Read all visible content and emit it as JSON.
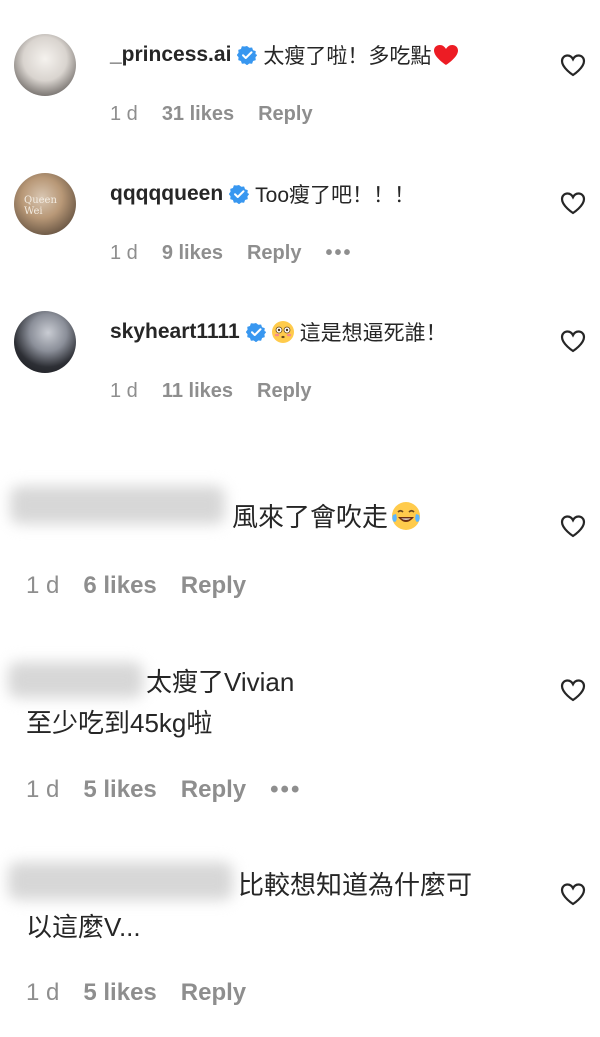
{
  "comments": [
    {
      "username": "_princess.ai",
      "text": "太瘦了啦！多吃點",
      "time": "1 d",
      "likes": "31 likes",
      "reply": "Reply",
      "more": ""
    },
    {
      "username": "qqqqqueen",
      "avatar_text": "Queen Wei",
      "text": "Too瘦了吧！！！",
      "time": "1 d",
      "likes": "9 likes",
      "reply": "Reply",
      "more": "•••"
    },
    {
      "username": "skyheart1111",
      "text": "這是想逼死誰！",
      "time": "1 d",
      "likes": "11 likes",
      "reply": "Reply",
      "more": ""
    },
    {
      "username": "",
      "text": "風來了會吹走",
      "time": "1 d",
      "likes": "6 likes",
      "reply": "Reply",
      "more": ""
    },
    {
      "username": "",
      "text_line1": "太瘦了Vivian",
      "text_line2": "至少吃到45kg啦",
      "time": "1 d",
      "likes": "5 likes",
      "reply": "Reply",
      "more": "•••"
    },
    {
      "username": "",
      "text_line1": "比較想知道為什麼可",
      "text_line2": "以這麼V...",
      "time": "1 d",
      "likes": "5 likes",
      "reply": "Reply",
      "more": ""
    }
  ],
  "colors": {
    "verified": "#3897f0",
    "heart_red": "#ed4956",
    "meta_gray": "#8e8e8e"
  },
  "icons": {
    "verified": "verified-badge-icon",
    "like": "heart-outline-icon",
    "more": "more-dots-icon"
  }
}
